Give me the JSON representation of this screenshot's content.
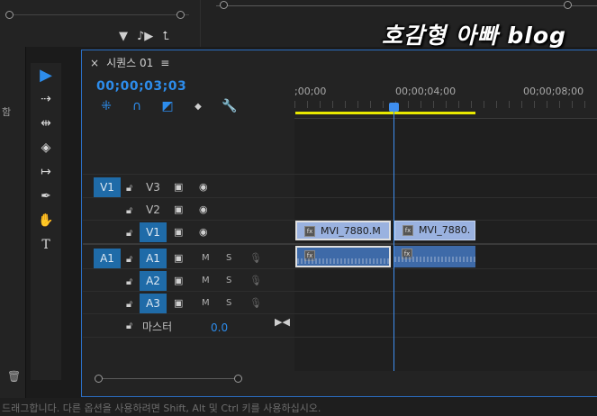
{
  "watermark": "호감형 아빠 blog",
  "source_icons": [
    "▼",
    "♪▶",
    "⮤"
  ],
  "left_char": "함",
  "tools": [
    {
      "name": "selection-tool-icon",
      "glyph": "▶"
    },
    {
      "name": "track-select-tool-icon",
      "glyph": "⇢"
    },
    {
      "name": "ripple-edit-tool-icon",
      "glyph": "⇹"
    },
    {
      "name": "razor-tool-icon",
      "glyph": "◈"
    },
    {
      "name": "slip-tool-icon",
      "glyph": "↦"
    },
    {
      "name": "pen-tool-icon",
      "glyph": "✒"
    },
    {
      "name": "hand-tool-icon",
      "glyph": "✋"
    },
    {
      "name": "type-tool-icon",
      "glyph": "T"
    }
  ],
  "sequence": {
    "close": "×",
    "name": "시퀀스 01",
    "menu": "≡",
    "timecode": "00;00;03;03",
    "tool_glyphs": [
      "⁜",
      "∩",
      "◩",
      "◆",
      "🔧"
    ]
  },
  "ruler": {
    "ticks": [
      ";00;00",
      "00;00;04;00",
      "00;00;08;00"
    ]
  },
  "tracks": {
    "v_target": "V1",
    "a_target": "A1",
    "video": [
      {
        "label": "V3"
      },
      {
        "label": "V2"
      },
      {
        "label": "V1"
      }
    ],
    "audio": [
      {
        "label": "A1",
        "m": "M",
        "s": "S"
      },
      {
        "label": "A2",
        "m": "M",
        "s": "S"
      },
      {
        "label": "A3",
        "m": "M",
        "s": "S"
      }
    ],
    "master": {
      "label": "마스터",
      "value": "0.0"
    }
  },
  "clips": {
    "video": [
      {
        "name": "MVI_7880.M",
        "fx": "fx"
      },
      {
        "name": "MVI_7880.",
        "fx": "fx"
      }
    ],
    "audio": [
      {
        "fx": "fx"
      },
      {
        "fx": "fx"
      }
    ]
  },
  "status": "드래그합니다. 다른 옵션을 사용하려면 Shift, Alt 및 Ctrl 키를 사용하십시오.",
  "colors": {
    "accent": "#2d8ceb",
    "target": "#1f6ba8",
    "work_area": "#e8e800",
    "video_clip": "#9ab2e0",
    "audio_clip": "#3e6aa8"
  }
}
